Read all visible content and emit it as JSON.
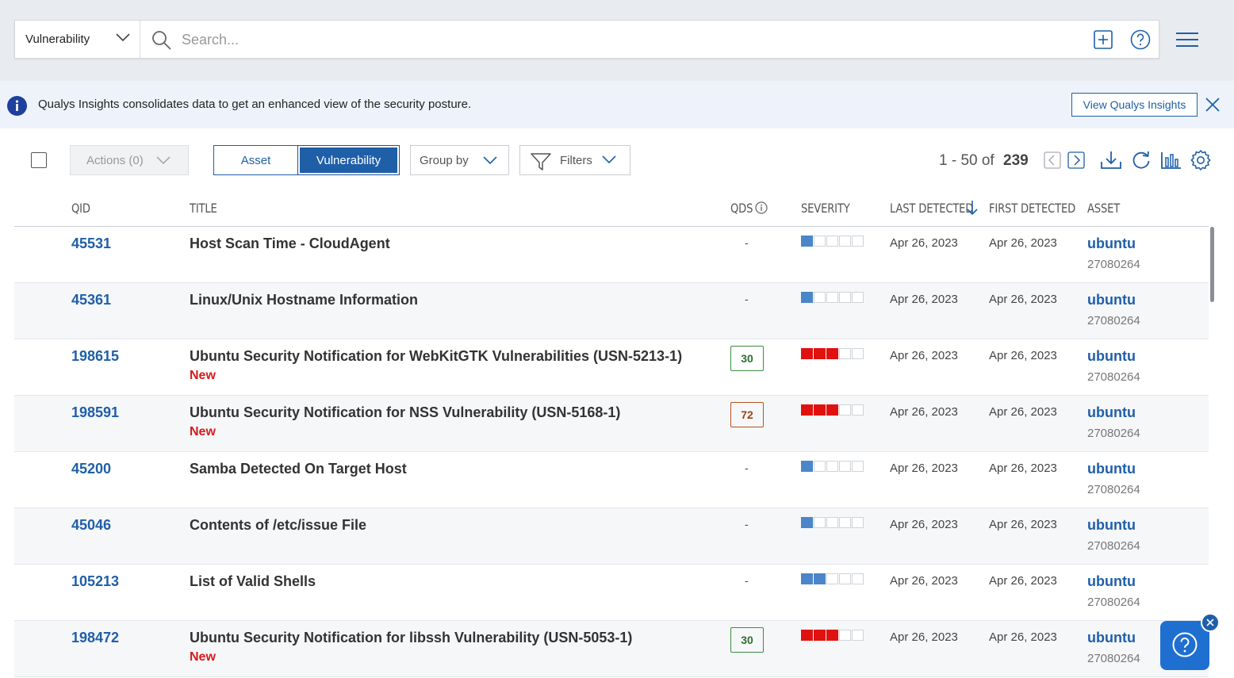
{
  "search": {
    "scope": "Vulnerability",
    "placeholder": "Search..."
  },
  "banner": {
    "message": "Qualys Insights consolidates data to get an enhanced view of the security posture.",
    "button": "View Qualys Insights"
  },
  "toolbar": {
    "actions": "Actions (0)",
    "toggle_asset": "Asset",
    "toggle_vulnerability": "Vulnerability",
    "group_by": "Group by",
    "filters": "Filters",
    "pager_range": "1 - 50 of",
    "pager_total": "239"
  },
  "table": {
    "headers": {
      "qid": "QID",
      "title": "TITLE",
      "qds": "QDS",
      "severity": "SEVERITY",
      "last_detected": "LAST DETECTED",
      "first_detected": "FIRST DETECTED",
      "asset": "ASSET"
    },
    "rows": [
      {
        "qid": "45531",
        "title": "Host Scan Time - CloudAgent",
        "tag": "",
        "qds": "-",
        "qds_level": "",
        "severity": 1,
        "severity_color": "#4a86c8",
        "last": "Apr 26, 2023",
        "first": "Apr 26, 2023",
        "asset": "ubuntu",
        "asset_id": "27080264"
      },
      {
        "qid": "45361",
        "title": "Linux/Unix Hostname Information",
        "tag": "",
        "qds": "-",
        "qds_level": "",
        "severity": 1,
        "severity_color": "#4a86c8",
        "last": "Apr 26, 2023",
        "first": "Apr 26, 2023",
        "asset": "ubuntu",
        "asset_id": "27080264"
      },
      {
        "qid": "198615",
        "title": "Ubuntu Security Notification for WebKitGTK Vulnerabilities (USN-5213-1)",
        "tag": "New",
        "qds": "30",
        "qds_level": "med",
        "severity": 3,
        "severity_color": "#e0120f",
        "last": "Apr 26, 2023",
        "first": "Apr 26, 2023",
        "asset": "ubuntu",
        "asset_id": "27080264"
      },
      {
        "qid": "198591",
        "title": "Ubuntu Security Notification for NSS Vulnerability (USN-5168-1)",
        "tag": "New",
        "qds": "72",
        "qds_level": "high",
        "severity": 3,
        "severity_color": "#e0120f",
        "last": "Apr 26, 2023",
        "first": "Apr 26, 2023",
        "asset": "ubuntu",
        "asset_id": "27080264"
      },
      {
        "qid": "45200",
        "title": "Samba Detected On Target Host",
        "tag": "",
        "qds": "-",
        "qds_level": "",
        "severity": 1,
        "severity_color": "#4a86c8",
        "last": "Apr 26, 2023",
        "first": "Apr 26, 2023",
        "asset": "ubuntu",
        "asset_id": "27080264"
      },
      {
        "qid": "45046",
        "title": "Contents of /etc/issue File",
        "tag": "",
        "qds": "-",
        "qds_level": "",
        "severity": 1,
        "severity_color": "#4a86c8",
        "last": "Apr 26, 2023",
        "first": "Apr 26, 2023",
        "asset": "ubuntu",
        "asset_id": "27080264"
      },
      {
        "qid": "105213",
        "title": "List of Valid Shells",
        "tag": "",
        "qds": "-",
        "qds_level": "",
        "severity": 2,
        "severity_color": "#4a86c8",
        "last": "Apr 26, 2023",
        "first": "Apr 26, 2023",
        "asset": "ubuntu",
        "asset_id": "27080264"
      },
      {
        "qid": "198472",
        "title": "Ubuntu Security Notification for libssh Vulnerability (USN-5053-1)",
        "tag": "New",
        "qds": "30",
        "qds_level": "med",
        "severity": 3,
        "severity_color": "#e0120f",
        "last": "Apr 26, 2023",
        "first": "Apr 26, 2023",
        "asset": "ubuntu",
        "asset_id": "27080264"
      }
    ]
  }
}
